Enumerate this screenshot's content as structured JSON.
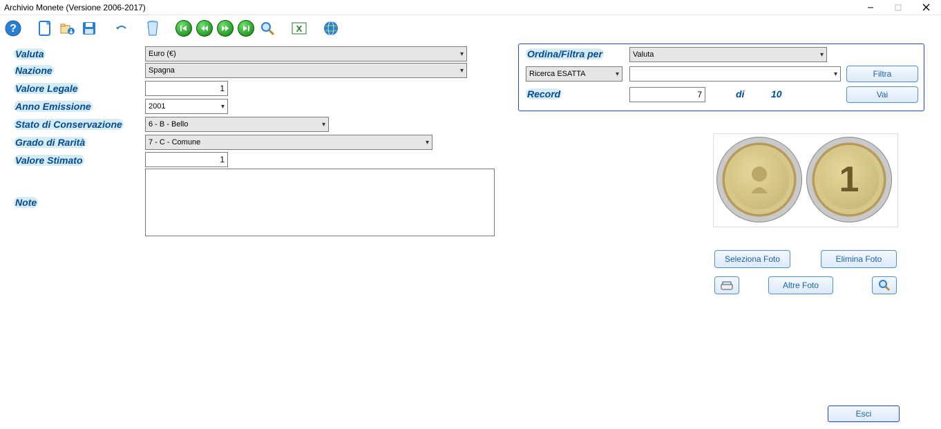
{
  "window": {
    "title": "Archivio Monete (Versione 2006-2017)"
  },
  "labels": {
    "valuta": "Valuta",
    "nazione": "Nazione",
    "valore_legale": "Valore Legale",
    "anno_emissione": "Anno Emissione",
    "stato_conservazione": "Stato di Conservazione",
    "grado_rarita": "Grado di Rarità",
    "valore_stimato": "Valore Stimato",
    "note": "Note"
  },
  "values": {
    "valuta": "Euro (€)",
    "nazione": "Spagna",
    "valore_legale": "1",
    "anno_emissione": "2001",
    "stato_conservazione": "6 - B   - Bello",
    "grado_rarita": "7 - C   - Comune",
    "valore_stimato": "1",
    "note": ""
  },
  "filter": {
    "title": "Ordina/Filtra per",
    "field": "Valuta",
    "mode": "Ricerca ESATTA",
    "value": "",
    "filtra_btn": "Filtra",
    "record_label": "Record",
    "record_value": "7",
    "di": "di",
    "total": "10",
    "vai_btn": "Vai"
  },
  "photo": {
    "seleziona": "Seleziona Foto",
    "elimina": "Elimina Foto",
    "altre": "Altre Foto"
  },
  "footer": {
    "esci": "Esci"
  }
}
